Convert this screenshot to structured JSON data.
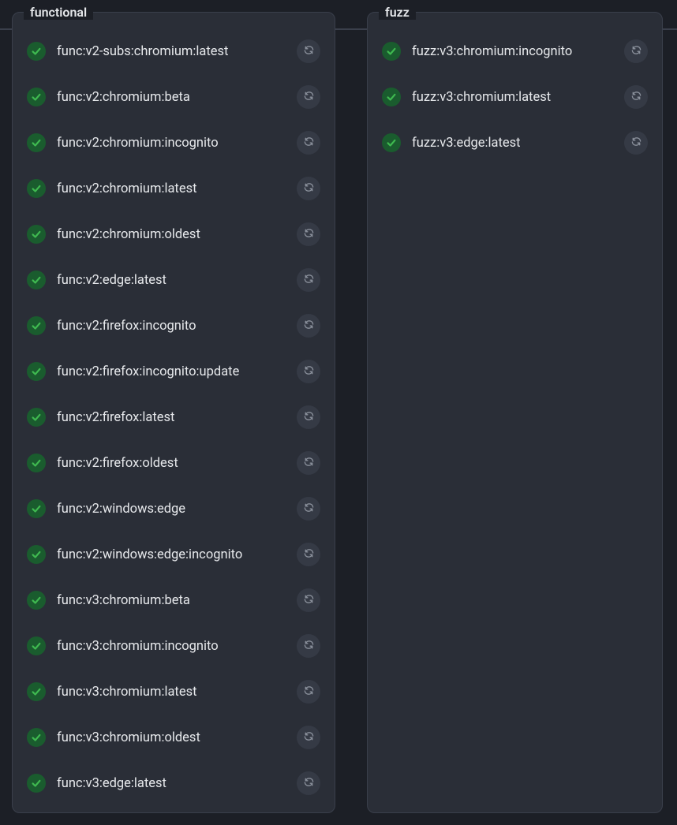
{
  "columns": [
    {
      "id": "functional",
      "title": "functional",
      "items": [
        {
          "label": "func:v2-subs:chromium:latest",
          "status": "success"
        },
        {
          "label": "func:v2:chromium:beta",
          "status": "success"
        },
        {
          "label": "func:v2:chromium:incognito",
          "status": "success"
        },
        {
          "label": "func:v2:chromium:latest",
          "status": "success"
        },
        {
          "label": "func:v2:chromium:oldest",
          "status": "success"
        },
        {
          "label": "func:v2:edge:latest",
          "status": "success"
        },
        {
          "label": "func:v2:firefox:incognito",
          "status": "success"
        },
        {
          "label": "func:v2:firefox:incognito:update",
          "status": "success"
        },
        {
          "label": "func:v2:firefox:latest",
          "status": "success"
        },
        {
          "label": "func:v2:firefox:oldest",
          "status": "success"
        },
        {
          "label": "func:v2:windows:edge",
          "status": "success"
        },
        {
          "label": "func:v2:windows:edge:incognito",
          "status": "success"
        },
        {
          "label": "func:v3:chromium:beta",
          "status": "success"
        },
        {
          "label": "func:v3:chromium:incognito",
          "status": "success"
        },
        {
          "label": "func:v3:chromium:latest",
          "status": "success"
        },
        {
          "label": "func:v3:chromium:oldest",
          "status": "success"
        },
        {
          "label": "func:v3:edge:latest",
          "status": "success"
        }
      ]
    },
    {
      "id": "fuzz",
      "title": "fuzz",
      "items": [
        {
          "label": "fuzz:v3:chromium:incognito",
          "status": "success"
        },
        {
          "label": "fuzz:v3:chromium:latest",
          "status": "success"
        },
        {
          "label": "fuzz:v3:edge:latest",
          "status": "success"
        }
      ]
    }
  ],
  "colors": {
    "bg": "#1c1f26",
    "panel": "#2a2e37",
    "border": "#3a3f4b",
    "text": "#e6e8eb",
    "success_bg": "#1a5c2e",
    "success_check": "#3fb950",
    "retry_bg": "#353a45",
    "retry_icon": "#8b919c"
  }
}
